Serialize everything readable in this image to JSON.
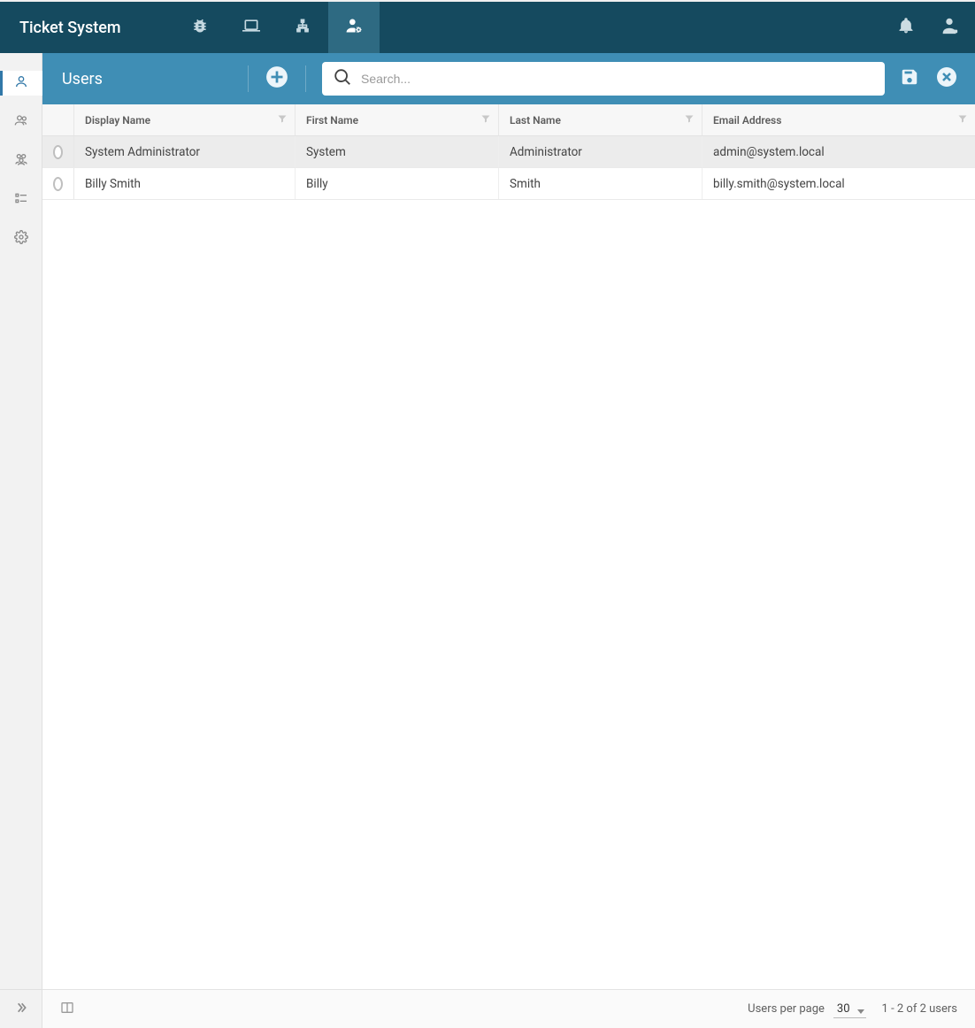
{
  "brand": "Ticket System",
  "topnav": {
    "items": [
      {
        "name": "bug"
      },
      {
        "name": "laptop"
      },
      {
        "name": "sitemap"
      },
      {
        "name": "user-admin",
        "active": true
      }
    ]
  },
  "toolbar": {
    "title": "Users",
    "search_placeholder": "Search..."
  },
  "leftnav": {
    "items": [
      {
        "name": "user",
        "active": true
      },
      {
        "name": "users"
      },
      {
        "name": "group"
      },
      {
        "name": "checklist"
      },
      {
        "name": "settings"
      }
    ]
  },
  "columns": {
    "display_name": "Display Name",
    "first_name": "First Name",
    "last_name": "Last Name",
    "email": "Email Address"
  },
  "rows": [
    {
      "display": "System Administrator",
      "first": "System",
      "last": "Administrator",
      "email": "admin@system.local",
      "selected": true
    },
    {
      "display": "Billy Smith",
      "first": "Billy",
      "last": "Smith",
      "email": "billy.smith@system.local",
      "selected": false
    }
  ],
  "footer": {
    "perpage_label": "Users per page",
    "perpage_value": "30",
    "range_text": "1 - 2 of 2 users"
  }
}
